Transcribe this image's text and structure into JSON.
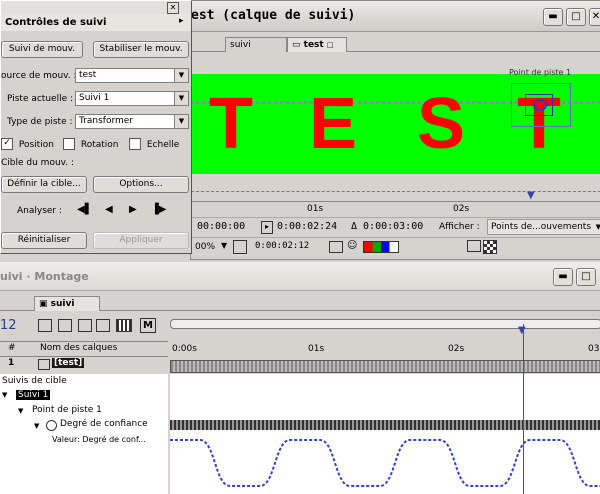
{
  "tracker_panel": {
    "title": "Contrôles de suivi",
    "track_motion_label": "Suivi de mouv.",
    "stabilize_label": "Stabiliser le mouv.",
    "source_label": "ource de mouv. :",
    "source_value": "test",
    "current_track_label": "Piste actuelle :",
    "current_track_value": "Suivi 1",
    "track_type_label": "Type de piste :",
    "track_type_value": "Transformer",
    "position_label": "Position",
    "rotation_label": "Rotation",
    "scale_label": "Echelle",
    "target_label": "Cible du mouv. :",
    "set_target_label": "Définir la cible...",
    "options_label": "Options...",
    "analyze_label": "Analyser :",
    "reset_label": "Réinitialiser",
    "apply_label": "Appliquer"
  },
  "layer_window": {
    "title": "est (calque de suivi)",
    "tab_inactive": "suivi",
    "tab_active": "test",
    "track_point_label": "Point de piste 1",
    "letters": [
      "T",
      "E",
      "S",
      "T"
    ],
    "ruler_ticks": [
      "01s",
      "02s"
    ],
    "time_start": "00:00:00",
    "time_current": "0:00:02:24",
    "time_duration": "Δ 0:00:03:00",
    "show_label": "Afficher :",
    "show_value": "Points de...ouvements",
    "zoom": "00%",
    "timecode_small": "0:00:02:12",
    "colors": {
      "comp_bg": "#00ff00",
      "text": "#ff0000"
    }
  },
  "timeline": {
    "title": "uivi · Montage",
    "tab_label": "suivi",
    "current_time": "12",
    "col_num": "#",
    "col_name": "Nom des calques",
    "layer_num": "1",
    "layer_name": "[test]",
    "ticks": [
      "0:00s",
      "01s",
      "02s",
      "03"
    ],
    "tree": {
      "group": "Suivis de cible",
      "track": "Suivi 1",
      "point": "Point de piste 1",
      "property": "Degré de confiance",
      "value": "Valeur: Degré de conf..."
    }
  }
}
